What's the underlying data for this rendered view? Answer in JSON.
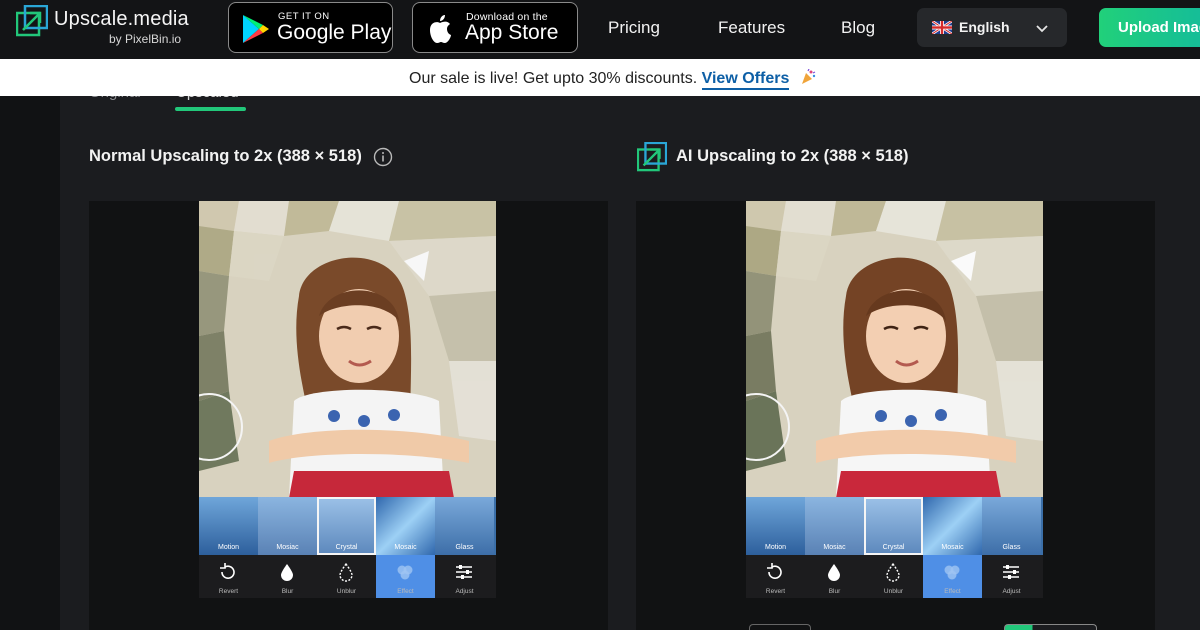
{
  "nav": {
    "logo_title": "Upscale.media",
    "logo_subtitle": "by PixelBin.io",
    "google_play_small": "GET IT ON",
    "google_play_big": "Google Play",
    "app_store_small": "Download on the",
    "app_store_big": "App Store",
    "links": [
      "Pricing",
      "Features",
      "Blog"
    ],
    "language": "English",
    "upload_label": "Upload Image"
  },
  "banner": {
    "text": "Our sale is live! Get upto 30% discounts.",
    "link": "View Offers"
  },
  "tabs": [
    "Original",
    "Upscaled"
  ],
  "active_tab": "Upscaled",
  "comparison": {
    "left_heading": "Normal Upscaling to 2x (388 × 518)",
    "right_heading": "AI Upscaling to 2x (388 × 518)"
  },
  "preview": {
    "filters": [
      "Motion",
      "Mosiac",
      "Crystal",
      "Mosaic",
      "Glass"
    ],
    "selected_filter": "Crystal",
    "tools": [
      "Revert",
      "Blur",
      "Unblur",
      "Effect",
      "Adjust"
    ],
    "active_tool": "Effect"
  },
  "colors": {
    "accent_green": "#22c77a",
    "offer_link": "#0d5fa6",
    "active_tool": "#4f8fe6"
  }
}
